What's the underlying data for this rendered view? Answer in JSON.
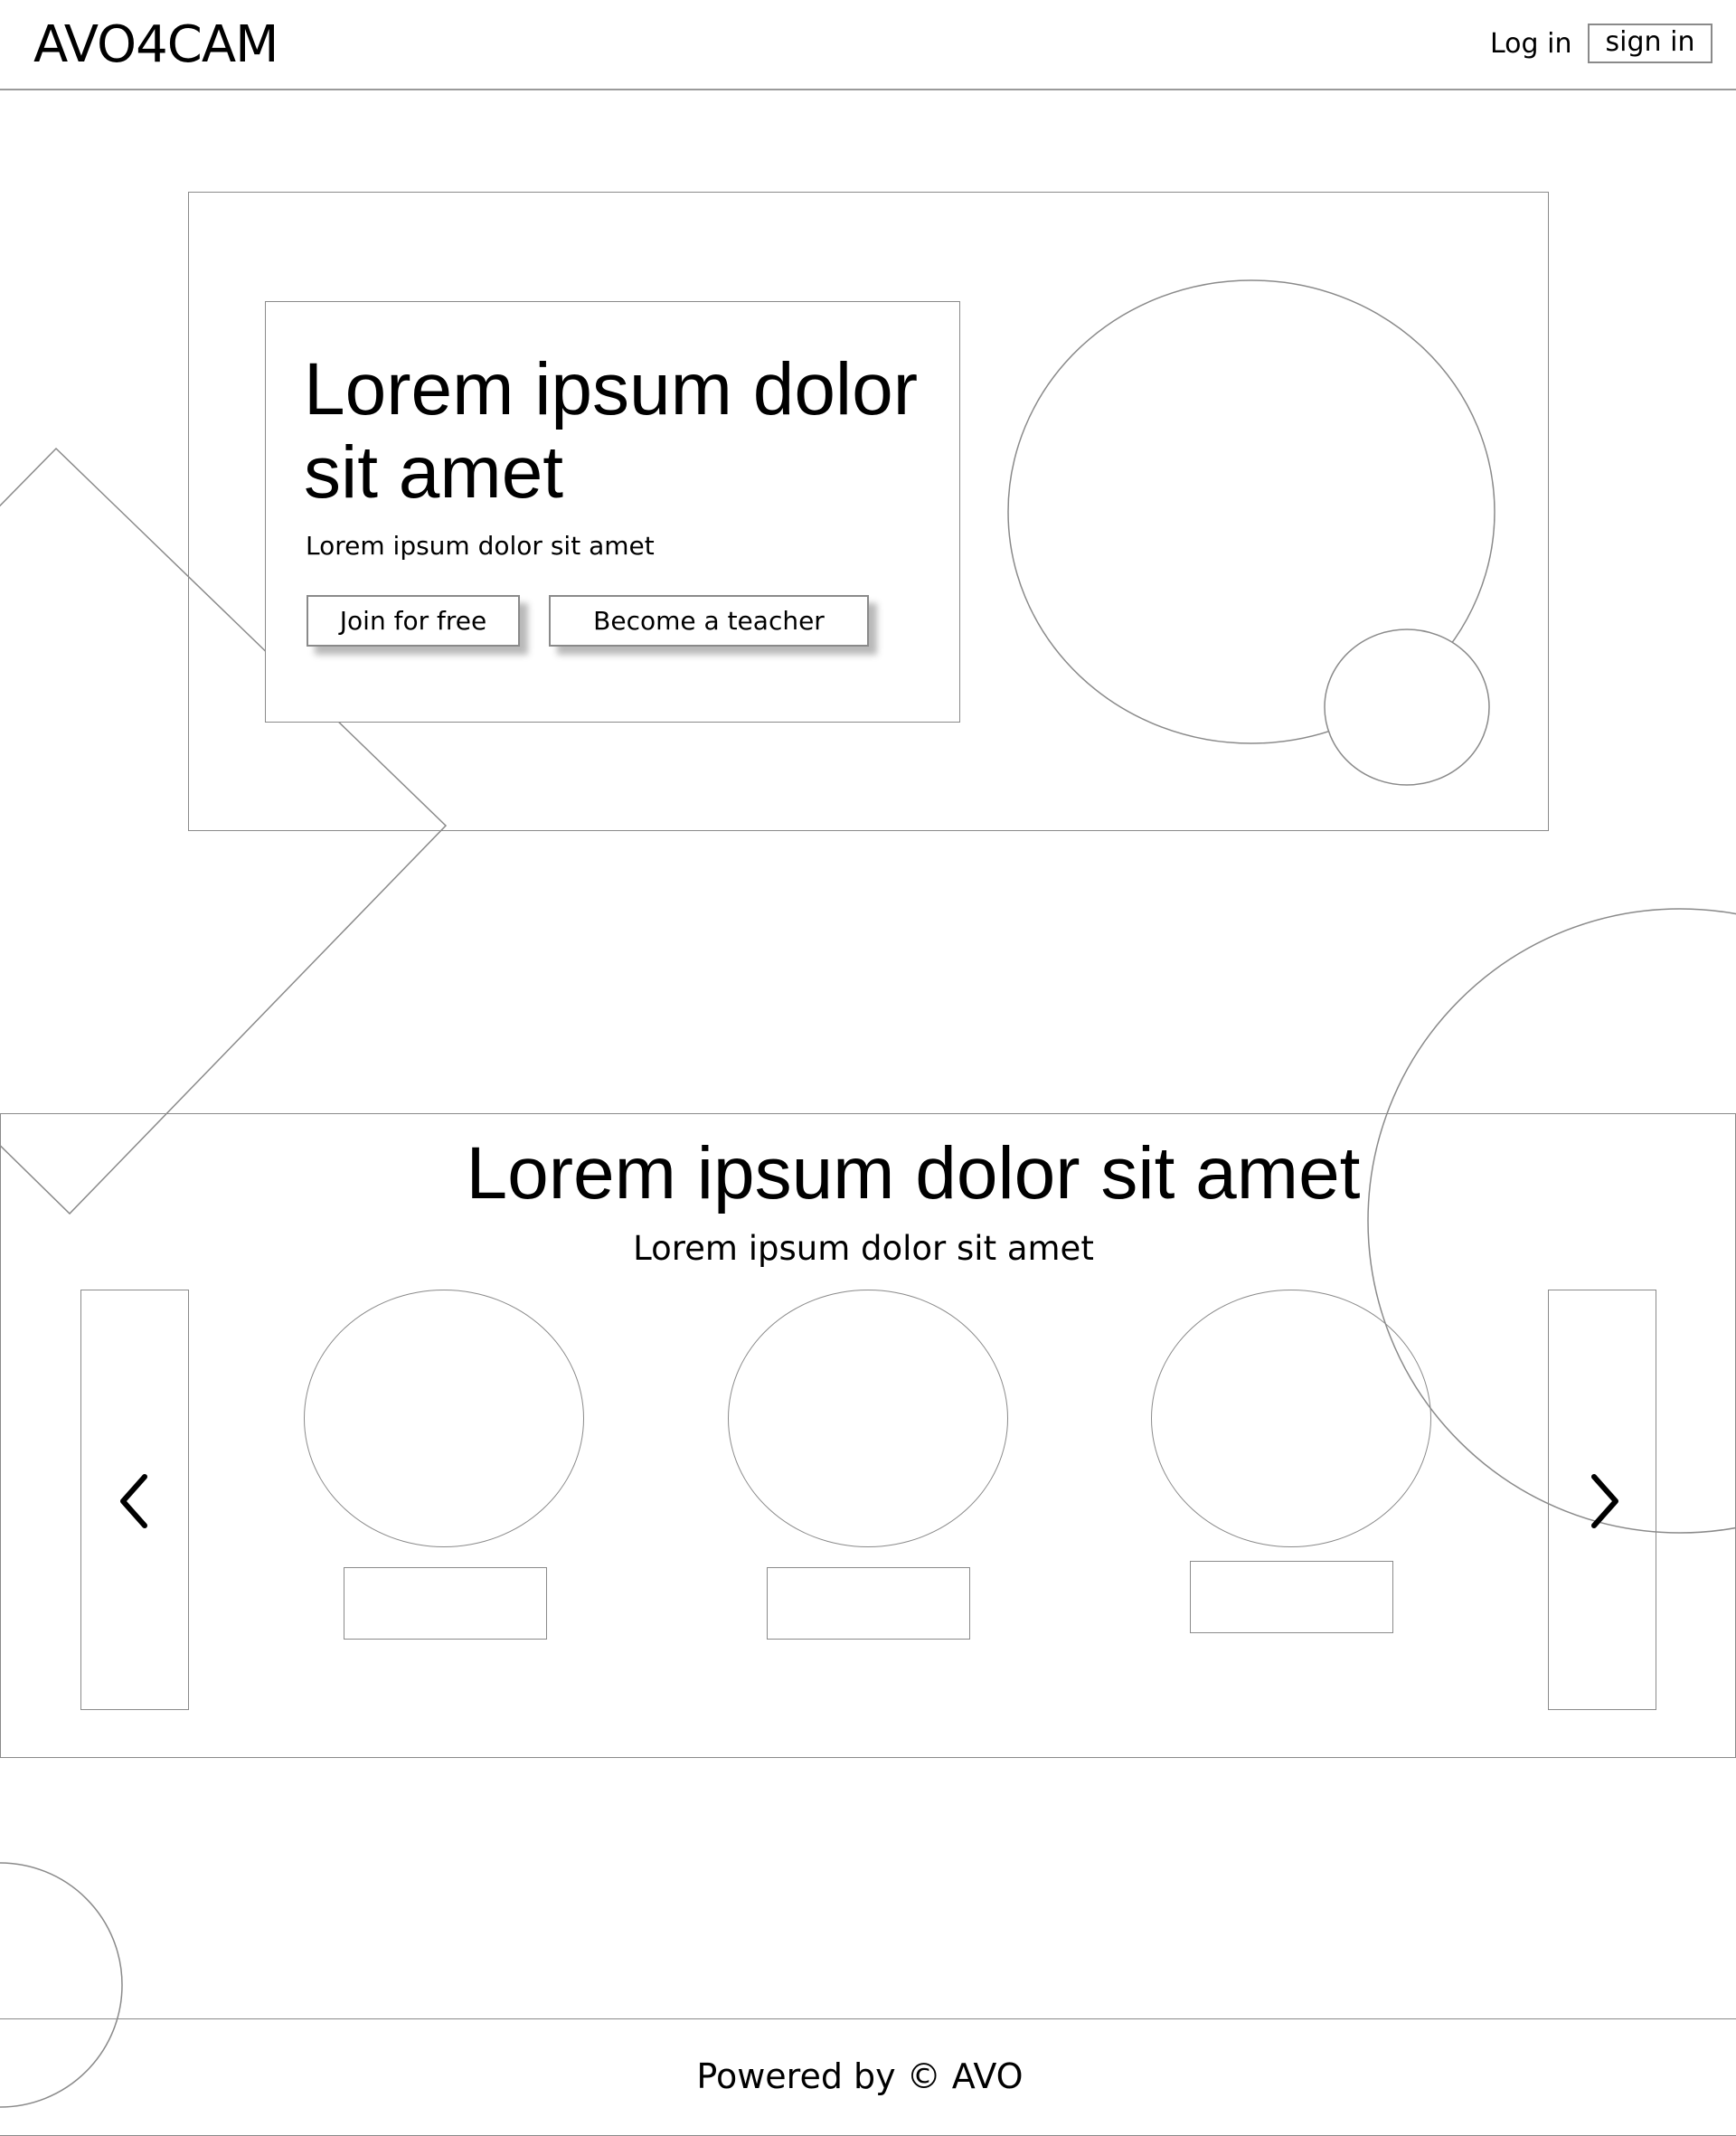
{
  "header": {
    "brand": "AVO4CAM",
    "login_label": "Log in",
    "signin_label": "sign in"
  },
  "hero": {
    "title": "Lorem ipsum dolor sit amet",
    "subtitle": "Lorem ipsum dolor sit amet",
    "join_label": "Join for free",
    "teacher_label": "Become a teacher"
  },
  "carousel": {
    "title": "Lorem ipsum dolor sit amet",
    "subtitle": "Lorem ipsum dolor sit amet",
    "prev_icon": "chevron-left-icon",
    "next_icon": "chevron-right-icon",
    "items": [
      {
        "avatar": "placeholder-circle",
        "label": ""
      },
      {
        "avatar": "placeholder-circle",
        "label": ""
      },
      {
        "avatar": "placeholder-circle",
        "label": ""
      }
    ]
  },
  "footer": {
    "text": "Powered by © AVO"
  },
  "colors": {
    "background": "#ffffff",
    "outline": "#8a8a8a",
    "text": "#000000"
  }
}
